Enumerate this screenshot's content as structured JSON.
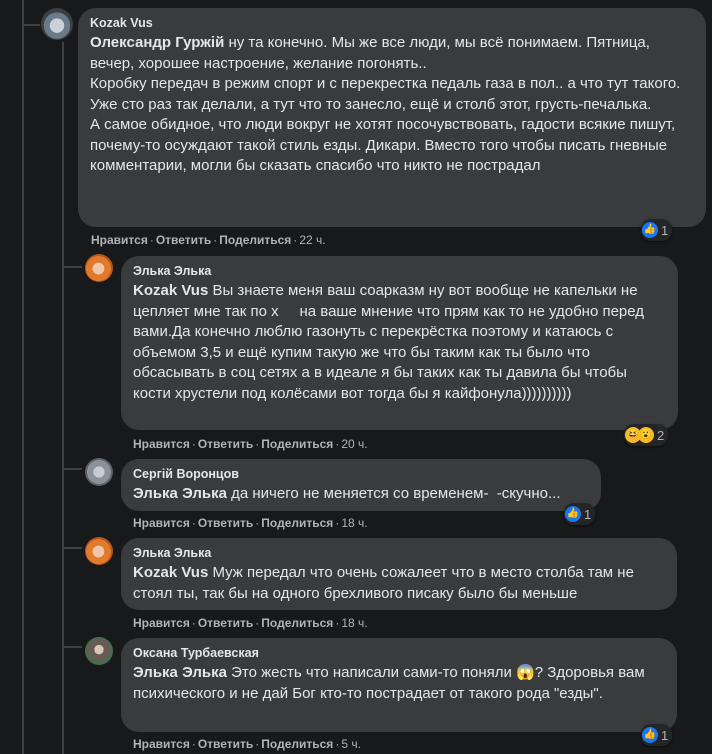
{
  "comments": [
    {
      "author": "Kozak Vus",
      "mention": "Олександр Гуржій",
      "text": " ну та конечно. Мы же все люди, мы всё понимаем. Пятница, вечер, хорошее настроение, желание погонять..\nКоробку передач в режим спорт и с перекрестка педаль газа в пол.. а что тут такого. Уже сто раз так делали, а тут что то занесло, ещё и столб этот, грусть-печалька.\nА самое обидное, что люди вокруг не хотят посочувствовать, гадости всякие пишут, почему-то осуждают такой стиль езды. Дикари. Вместо того чтобы писать гневные комментарии, могли бы сказать спасибо что никто не пострадал",
      "like": "Нравится",
      "reply": "Ответить",
      "share": "Поделиться",
      "time": "22 ч.",
      "reaction_count": "1",
      "reaction_icons": [
        "like-icon"
      ]
    },
    {
      "author": "Элька Элька",
      "mention": "Kozak Vus",
      "text": " Вы знаете меня ваш соарказм ну вот вообще не капельки не цепляет мне так по х     на ваше мнение что прям как то не удобно перед вами.Да конечно люблю газонуть с перекрёстка поэтому и катаюсь с объемом 3,5 и ещё купим такую же что бы таким как ты было что обсасывать в соц сетях а в идеале я бы таких как ты давила бы чтобы кости хрустели под колёсами вот тогда бы я кайфонула))))))))))",
      "like": "Нравится",
      "reply": "Ответить",
      "share": "Поделиться",
      "time": "20 ч.",
      "reaction_count": "2",
      "reaction_icons": [
        "haha-icon",
        "wow-icon"
      ]
    },
    {
      "author": "Сергій Воронцов",
      "mention": "Элька Элька",
      "text": " да ничего не меняется со временем-  -скучно...",
      "like": "Нравится",
      "reply": "Ответить",
      "share": "Поделиться",
      "time": "18 ч.",
      "reaction_count": "1",
      "reaction_icons": [
        "like-icon"
      ]
    },
    {
      "author": "Элька Элька",
      "mention": "Kozak Vus",
      "text": " Муж передал что очень сожалеет что в место столба там не стоял ты, так бы на одного брехливого писаку было бы меньше",
      "like": "Нравится",
      "reply": "Ответить",
      "share": "Поделиться",
      "time": "18 ч."
    },
    {
      "author": "Оксана Турбаевская",
      "mention": "Элька Элька",
      "text_before": " Это жесть что написали сами-то поняли ",
      "emoji": "😱",
      "text_after": "? Здоровья вам психического и не дай Бог кто-то пострадает от такого рода \"езды\".",
      "like": "Нравится",
      "reply": "Ответить",
      "share": "Поделиться",
      "time": "5 ч.",
      "reaction_count": "1",
      "reaction_icons": [
        "like-icon"
      ]
    }
  ],
  "separator": "·",
  "icon_glyphs": {
    "like": "👍",
    "haha": "😆",
    "wow": "😮"
  }
}
